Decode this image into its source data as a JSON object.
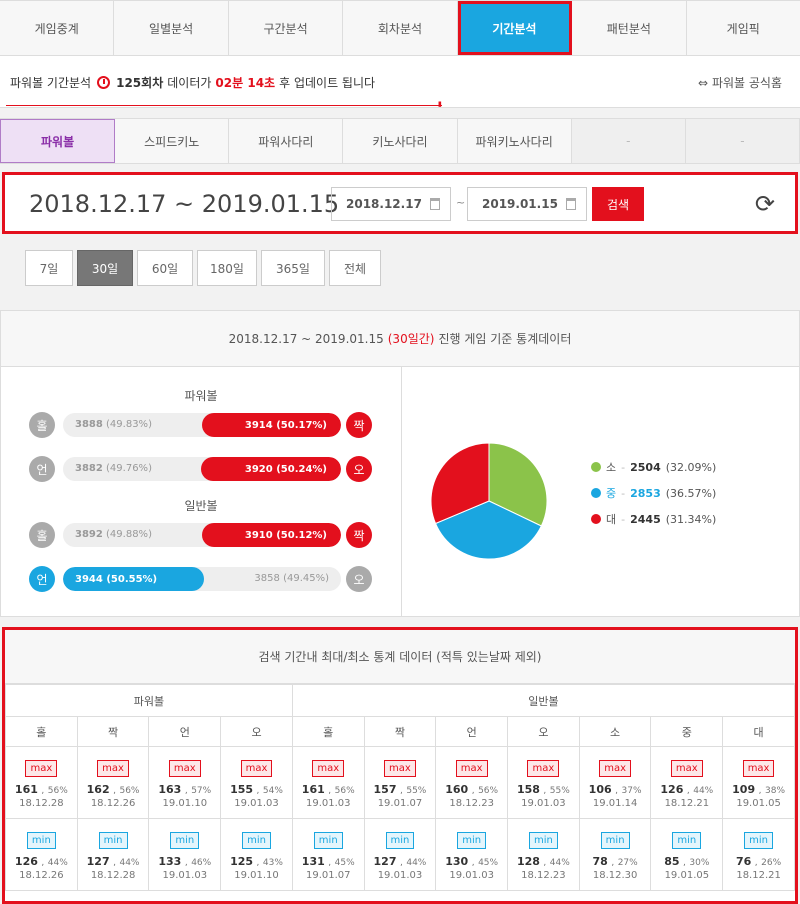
{
  "nav": {
    "tabs": [
      "게임중계",
      "일별분석",
      "구간분석",
      "회차분석",
      "기간분석",
      "패턴분석",
      "게임픽"
    ],
    "active": 4
  },
  "notice": {
    "prefix": "파워볼 기간분석",
    "round": "125회차",
    "mid": "데이터가",
    "time": "02분 14초",
    "suffix": "후 업데이트 됩니다",
    "home": "파워볼 공식홈"
  },
  "games": {
    "tabs": [
      "파워볼",
      "스피드키노",
      "파워사다리",
      "키노사다리",
      "파워키노사다리",
      "-",
      "-"
    ],
    "active": 0
  },
  "range": {
    "title": "2018.12.17 ~ 2019.01.15",
    "from": "2018.12.17",
    "to": "2019.01.15",
    "tilde": "~",
    "search": "검색"
  },
  "periods": [
    "7일",
    "30일",
    "60일",
    "180일",
    "365일",
    "전체"
  ],
  "period_active": 1,
  "stats": {
    "header": {
      "pre": "2018.12.17 ~ 2019.01.15",
      "days": "(30일간)",
      "post": "진행 게임 기준 통계데이터"
    },
    "powerball_title": "파워볼",
    "normal_title": "일반볼",
    "rows": [
      {
        "left": "홀",
        "right": "짝",
        "left_val": "3888",
        "left_pct": "(49.83%)",
        "right_val": "3914",
        "right_pct": "(50.17%)",
        "win": "right",
        "fill": 50.17
      },
      {
        "left": "언",
        "right": "오",
        "left_val": "3882",
        "left_pct": "(49.76%)",
        "right_val": "3920",
        "right_pct": "(50.24%)",
        "win": "right",
        "fill": 50.24
      },
      {
        "left": "홀",
        "right": "짝",
        "left_val": "3892",
        "left_pct": "(49.88%)",
        "right_val": "3910",
        "right_pct": "(50.12%)",
        "win": "right",
        "fill": 50.12
      },
      {
        "left": "언",
        "right": "오",
        "left_val": "3944",
        "left_pct": "(50.55%)",
        "right_val": "3858",
        "right_pct": "(49.45%)",
        "win": "left",
        "fill": 50.55
      }
    ],
    "pie": [
      {
        "label": "소",
        "sep": "-",
        "value": "2504",
        "pct": "(32.09%)",
        "color": "#8bc34a",
        "frac": 0.3209
      },
      {
        "label": "중",
        "sep": "-",
        "value": "2853",
        "pct": "(36.57%)",
        "color": "#1aa6e0",
        "frac": 0.3657
      },
      {
        "label": "대",
        "sep": "-",
        "value": "2445",
        "pct": "(31.34%)",
        "color": "#e3101d",
        "frac": 0.3134
      }
    ]
  },
  "minmax": {
    "header": "검색 기간내 최대/최소 통계 데이터 (적특 있는날짜 제외)",
    "groups": [
      "파워볼",
      "일반볼"
    ],
    "cols": [
      "홀",
      "짝",
      "언",
      "오",
      "홀",
      "짝",
      "언",
      "오",
      "소",
      "중",
      "대"
    ],
    "max_tag": "max",
    "min_tag": "min",
    "max": [
      [
        "161",
        "56%",
        "18.12.28"
      ],
      [
        "162",
        "56%",
        "18.12.26"
      ],
      [
        "163",
        "57%",
        "19.01.10"
      ],
      [
        "155",
        "54%",
        "19.01.03"
      ],
      [
        "161",
        "56%",
        "19.01.03"
      ],
      [
        "157",
        "55%",
        "19.01.07"
      ],
      [
        "160",
        "56%",
        "18.12.23"
      ],
      [
        "158",
        "55%",
        "19.01.03"
      ],
      [
        "106",
        "37%",
        "19.01.14"
      ],
      [
        "126",
        "44%",
        "18.12.21"
      ],
      [
        "109",
        "38%",
        "19.01.05"
      ]
    ],
    "min": [
      [
        "126",
        "44%",
        "18.12.26"
      ],
      [
        "127",
        "44%",
        "18.12.28"
      ],
      [
        "133",
        "46%",
        "19.01.03"
      ],
      [
        "125",
        "43%",
        "19.01.10"
      ],
      [
        "131",
        "45%",
        "19.01.07"
      ],
      [
        "127",
        "44%",
        "19.01.03"
      ],
      [
        "130",
        "45%",
        "19.01.03"
      ],
      [
        "128",
        "44%",
        "18.12.23"
      ],
      [
        "78",
        "27%",
        "18.12.30"
      ],
      [
        "85",
        "30%",
        "19.01.05"
      ],
      [
        "76",
        "26%",
        "18.12.21"
      ]
    ]
  }
}
